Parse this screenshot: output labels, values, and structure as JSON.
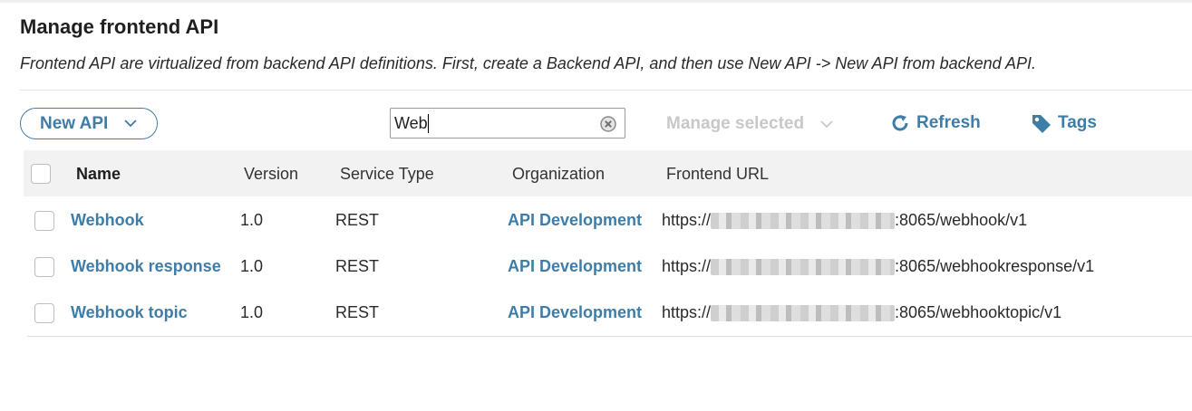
{
  "page": {
    "title": "Manage frontend API",
    "subtitle": "Frontend API are virtualized from backend API definitions. First, create a Backend API, and then use New API -> New API from backend API."
  },
  "toolbar": {
    "new_api_label": "New API",
    "search_value": "Web",
    "manage_selected_label": "Manage selected",
    "refresh_label": "Refresh",
    "tags_label": "Tags"
  },
  "table": {
    "headers": {
      "name": "Name",
      "version": "Version",
      "service_type": "Service Type",
      "organization": "Organization",
      "frontend_url": "Frontend URL"
    },
    "rows": [
      {
        "name": "Webhook",
        "version": "1.0",
        "service_type": "REST",
        "organization": "API Development",
        "url_prefix": "https://",
        "url_suffix": ":8065/webhook/v1"
      },
      {
        "name": "Webhook response",
        "version": "1.0",
        "service_type": "REST",
        "organization": "API Development",
        "url_prefix": "https://",
        "url_suffix": ":8065/webhookresponse/v1"
      },
      {
        "name": "Webhook topic",
        "version": "1.0",
        "service_type": "REST",
        "organization": "API Development",
        "url_prefix": "https://",
        "url_suffix": ":8065/webhooktopic/v1"
      }
    ]
  },
  "colors": {
    "accent": "#3e7da8",
    "disabled_text": "#c8c8c8",
    "header_bg": "#f2f2f2"
  },
  "icons": [
    "chevron-down-icon",
    "clear-icon",
    "refresh-icon",
    "tag-icon"
  ]
}
